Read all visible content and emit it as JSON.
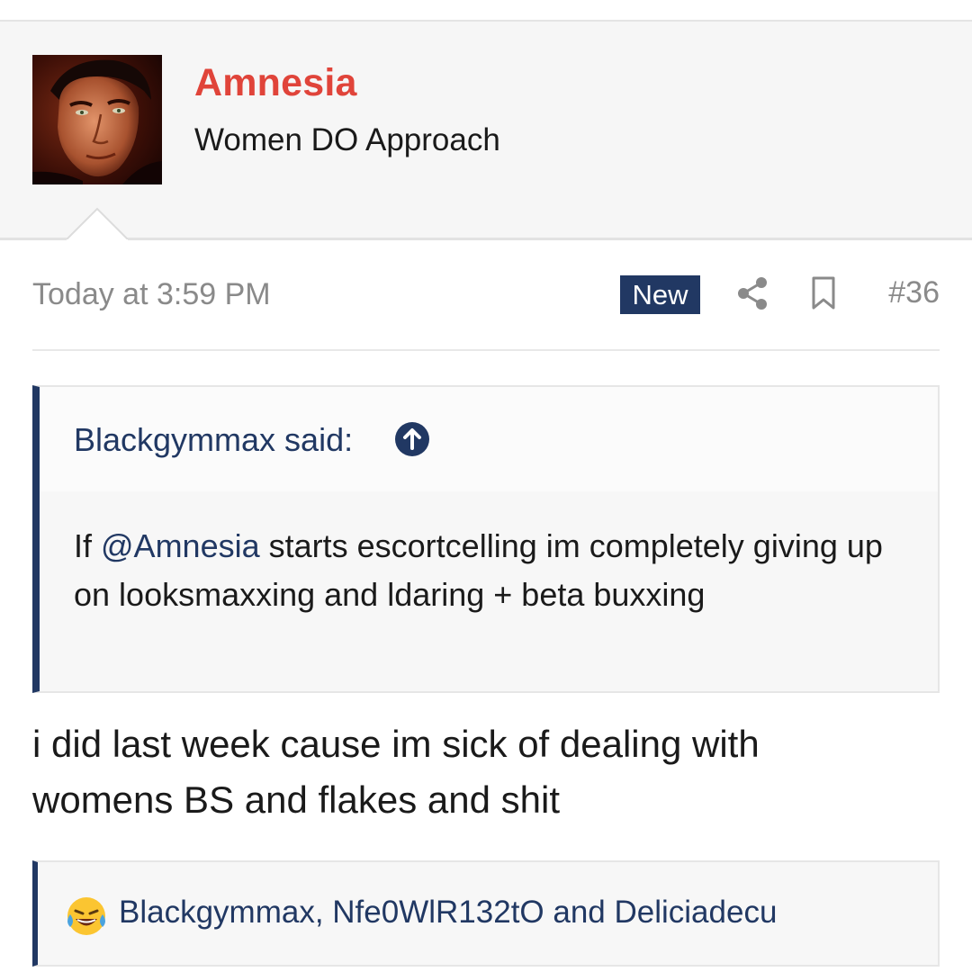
{
  "user": {
    "name": "Amnesia",
    "title": "Women DO Approach",
    "name_color": "#e0443a"
  },
  "post": {
    "date": "Today at 3:59 PM",
    "badge": "New",
    "number": "#36",
    "body_line1": "i did last week cause im sick of dealing with",
    "body_line2": "womens BS and flakes and shit"
  },
  "icons": {
    "share": "share-icon",
    "bookmark": "bookmark-icon",
    "quote_jump": "arrow-up-circle-icon",
    "reaction": "laughing-tears-emoji"
  },
  "quote": {
    "author_said": "Blackgymmax said:",
    "text_before": "If ",
    "mention": "@Amnesia",
    "text_after": " starts escortcelling im completely giving up on looksmaxxing and ldaring + beta buxxing"
  },
  "reactions": {
    "users": "Blackgymmax, Nfe0WlR132tO and Deliciadecu"
  },
  "colors": {
    "accent": "#213863",
    "username": "#e0443a",
    "muted": "#8a8a8a"
  }
}
